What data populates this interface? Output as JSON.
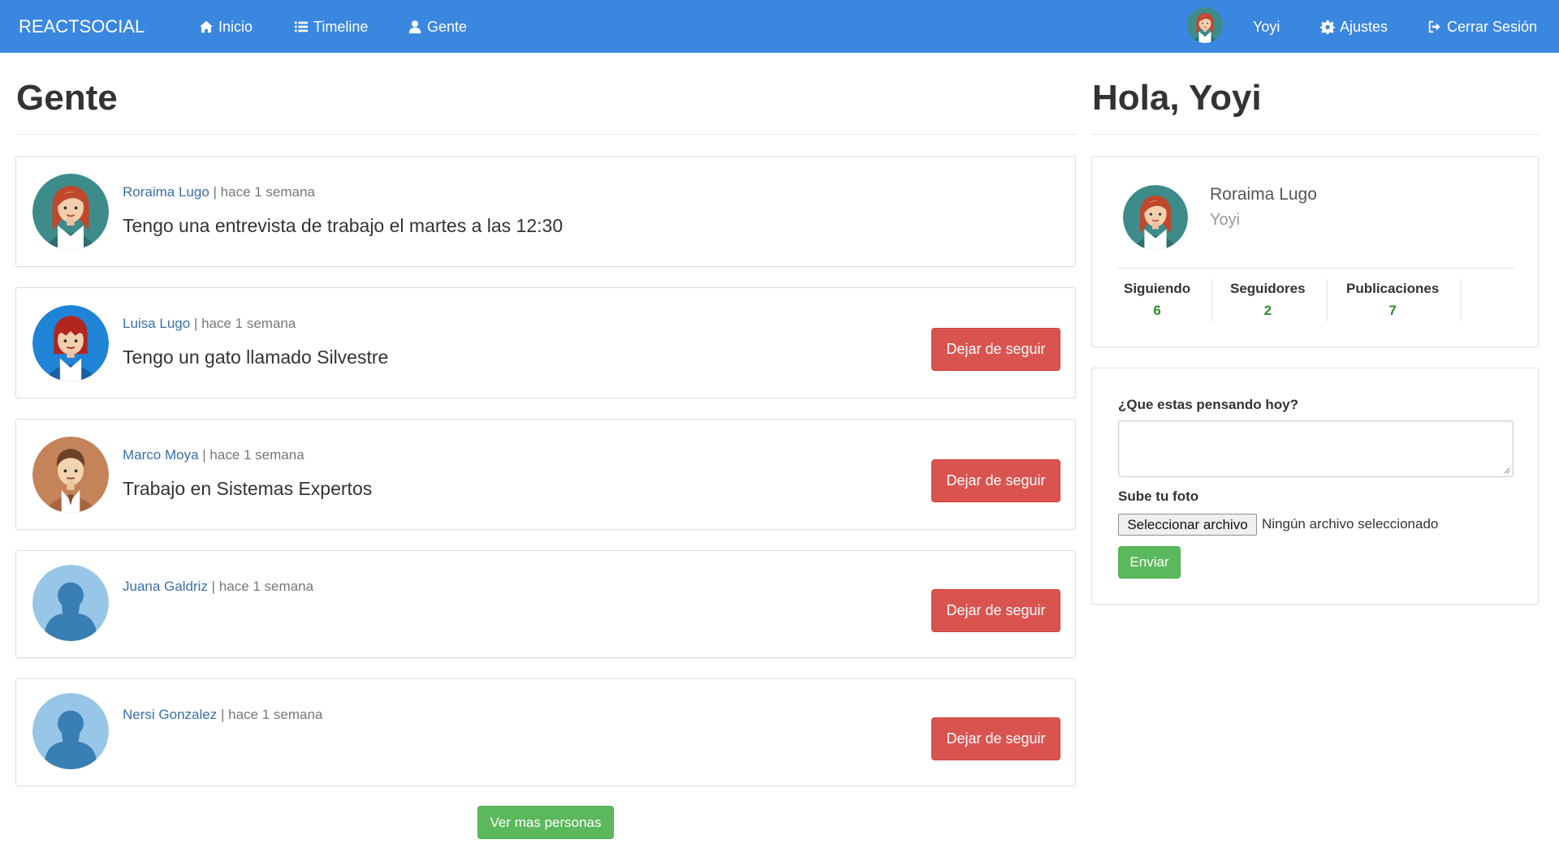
{
  "navbar": {
    "brand": "REACTSOCIAL",
    "links": [
      {
        "label": "Inicio",
        "icon": "home-icon"
      },
      {
        "label": "Timeline",
        "icon": "list-icon"
      },
      {
        "label": "Gente",
        "icon": "user-icon"
      }
    ],
    "user_name": "Yoyi",
    "settings_label": "Ajustes",
    "logout_label": "Cerrar Sesión",
    "background": "#3a87e0"
  },
  "main": {
    "title": "Gente",
    "people": [
      {
        "name": "Roraima Lugo",
        "time": "hace 1 semana",
        "bio": "Tengo una entrevista de trabajo el martes a las 12:30",
        "avatar": "woman-redhair-avatar",
        "show_button": false
      },
      {
        "name": "Luisa Lugo",
        "time": "hace 1 semana",
        "bio": "Tengo un gato llamado Silvestre",
        "avatar": "woman-bangs-avatar",
        "show_button": true
      },
      {
        "name": "Marco Moya",
        "time": "hace 1 semana",
        "bio": "Trabajo en Sistemas Expertos",
        "avatar": "man-avatar",
        "show_button": true
      },
      {
        "name": "Juana Galdriz",
        "time": "hace 1 semana",
        "bio": "",
        "avatar": "default-user-avatar",
        "show_button": true
      },
      {
        "name": "Nersi Gonzalez",
        "time": "hace 1 semana",
        "bio": "",
        "avatar": "default-user-avatar",
        "show_button": true
      }
    ],
    "separator": "|",
    "unfollow_label": "Dejar de seguir",
    "more_label": "Ver mas personas"
  },
  "sidebar": {
    "greeting": "Hola, Yoyi",
    "profile": {
      "name": "Roraima Lugo",
      "nick": "Yoyi"
    },
    "stats": [
      {
        "label": "Siguiendo",
        "value": 6
      },
      {
        "label": "Seguidores",
        "value": 2
      },
      {
        "label": "Publicaciones",
        "value": 7
      }
    ],
    "form": {
      "question": "¿Que estas pensando hoy?",
      "textarea_value": "",
      "upload_label": "Sube tu foto",
      "file_button": "Seleccionar archivo",
      "file_status": "Ningún archivo seleccionado",
      "submit_label": "Enviar"
    }
  },
  "colors": {
    "danger": "#d9534f",
    "success": "#5cb85c",
    "link": "#3a6fa8",
    "stat_number": "#2e8b2e"
  }
}
